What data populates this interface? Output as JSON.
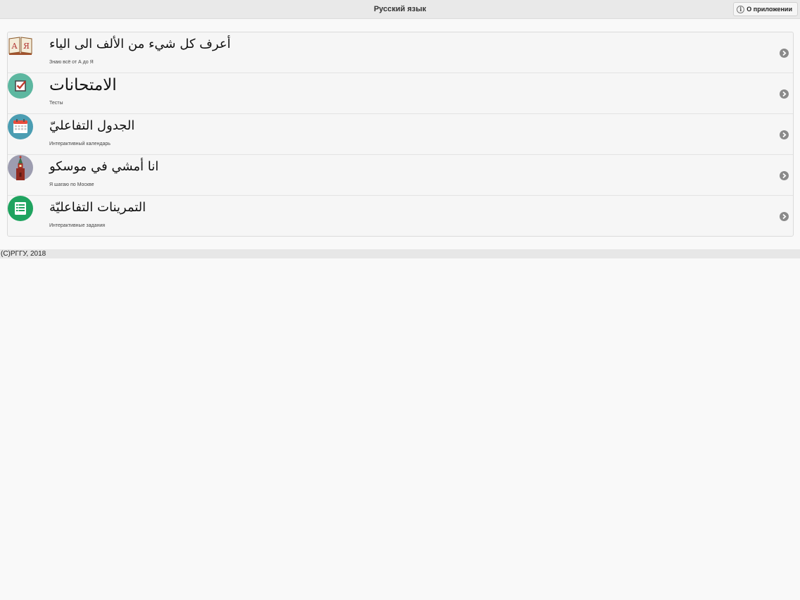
{
  "header": {
    "title": "Русский язык",
    "about_label": "О приложении"
  },
  "list": {
    "items": [
      {
        "title": "أعرف كل شيء من الألف الى الياء",
        "subtitle": "Знаю всё от А до Я",
        "icon": "book-icon",
        "color": "#b04040"
      },
      {
        "title": "الامتحانات",
        "subtitle": "Тесты",
        "icon": "checkbox-icon",
        "color": "#5db7a0"
      },
      {
        "title": "الجدول التفاعليّ",
        "subtitle": "Интерактивный календарь",
        "icon": "calendar-icon",
        "color": "#4b9db2"
      },
      {
        "title": "انا أمشي في موسكو",
        "subtitle": "Я шагаю по Москве",
        "icon": "kremlin-tower-icon",
        "color": "#9d9db0"
      },
      {
        "title": "التمرينات التفاعليّة",
        "subtitle": "Интерактивные задания",
        "icon": "list-icon",
        "color": "#1fa35f"
      }
    ]
  },
  "footer": {
    "text": "(C)РГГУ, 2018"
  }
}
